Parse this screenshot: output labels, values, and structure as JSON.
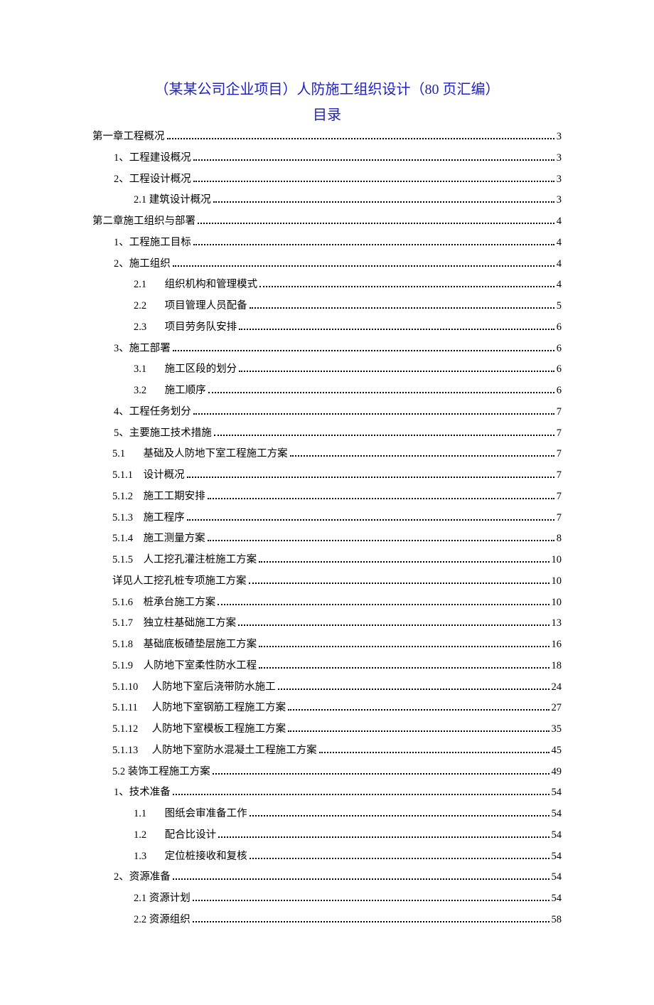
{
  "title_line1": "（某某公司企业项目）人防施工组织设计（80 页汇编）",
  "title_line2": "目录",
  "toc": [
    {
      "level": 0,
      "text": "第一章工程概况",
      "page": "3"
    },
    {
      "level": 1,
      "text": "1、工程建设概况",
      "page": "3"
    },
    {
      "level": 1,
      "text": "2、工程设计概况",
      "page": "3"
    },
    {
      "level": 2,
      "text": "2.1 建筑设计概况",
      "page": "3"
    },
    {
      "level": 0,
      "text": "第二章施工组织与部署",
      "page": "4"
    },
    {
      "level": 1,
      "text": "1、工程施工目标",
      "page": "4"
    },
    {
      "level": 1,
      "text": "2、施工组织",
      "page": "4"
    },
    {
      "level": 2,
      "num": "2.1",
      "text": "组织机构和管理模式",
      "page": "4"
    },
    {
      "level": 2,
      "num": "2.2",
      "text": "项目管理人员配备",
      "page": "5"
    },
    {
      "level": 2,
      "num": "2.3",
      "text": "项目劳务队安排",
      "page": "6"
    },
    {
      "level": 1,
      "text": "3、施工部署",
      "page": "6"
    },
    {
      "level": 2,
      "num": "3.1",
      "text": "施工区段的划分",
      "page": "6"
    },
    {
      "level": 2,
      "num": "3.2",
      "text": "施工顺序",
      "page": "6"
    },
    {
      "level": 1,
      "text": "4、工程任务划分",
      "page": "7"
    },
    {
      "level": 1,
      "text": "5、主要施工技术措施",
      "page": "7"
    },
    {
      "level": "1b",
      "num": "5.1",
      "text": "基础及人防地下室工程施工方案",
      "page": "7"
    },
    {
      "level": "1b",
      "num": "5.1.1",
      "text": "设计概况",
      "page": "7"
    },
    {
      "level": "1b",
      "num": "5.1.2",
      "text": "施工工期安排",
      "page": "7"
    },
    {
      "level": "1b",
      "num": "5.1.3",
      "text": "施工程序",
      "page": "7"
    },
    {
      "level": "1b",
      "num": "5.1.4",
      "text": "施工测量方案",
      "page": "8"
    },
    {
      "level": "1b",
      "num": "5.1.5",
      "text": "人工挖孔灌注桩施工方案",
      "page": "10"
    },
    {
      "level": "1b",
      "text": "详见人工挖孔桩专项施工方案",
      "page": "10"
    },
    {
      "level": "1b",
      "num": "5.1.6",
      "text": "桩承台施工方案",
      "page": "10"
    },
    {
      "level": "1b",
      "num": "5.1.7",
      "text": "独立柱基础施工方案",
      "page": "13"
    },
    {
      "level": "1b",
      "num": "5.1.8",
      "text": "基础底板碴垫层施工方案",
      "page": "16"
    },
    {
      "level": "1b",
      "num": "5.1.9",
      "text": "人防地下室柔性防水工程",
      "page": "18"
    },
    {
      "level": "1b",
      "numw": "5.1.10",
      "text": "人防地下室后浇带防水施工",
      "page": "24"
    },
    {
      "level": "1b",
      "numw": "5.1.11",
      "text": "人防地下室钢筋工程施工方案",
      "page": "27"
    },
    {
      "level": "1b",
      "numw": "5.1.12",
      "text": "人防地下室模板工程施工方案",
      "page": "35"
    },
    {
      "level": "1b",
      "numw": "5.1.13",
      "text": "人防地下室防水混凝土工程施工方案",
      "page": "45"
    },
    {
      "level": "1b",
      "text": "5.2 装饰工程施工方案",
      "page": "49"
    },
    {
      "level": 1,
      "text": "1、技术准备",
      "page": "54"
    },
    {
      "level": 2,
      "num": "1.1",
      "text": "图纸会审准备工作",
      "page": "54"
    },
    {
      "level": 2,
      "num": "1.2",
      "text": "配合比设计",
      "page": "54"
    },
    {
      "level": 2,
      "num": "1.3",
      "text": "定位桩接收和复核",
      "page": "54"
    },
    {
      "level": 1,
      "text": "2、资源准备",
      "page": "54"
    },
    {
      "level": 2,
      "text": "2.1 资源计划",
      "page": "54"
    },
    {
      "level": 2,
      "text": "2.2 资源组织",
      "page": "58"
    }
  ]
}
